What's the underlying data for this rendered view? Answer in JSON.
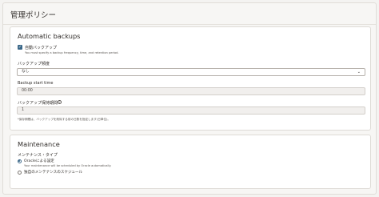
{
  "page": {
    "title": "管理ポリシー"
  },
  "backups": {
    "title": "Automatic backups",
    "auto_backup": {
      "label": "自動バックアップ",
      "hint": "You must specify a backup frequency, time, and retention period."
    },
    "frequency": {
      "label": "バックアップ頻度",
      "value": "なし"
    },
    "start_time": {
      "label": "Backup start time",
      "value": "00:00"
    },
    "retention": {
      "label": "バックアップ保持期間",
      "value": "1"
    },
    "note": "*保存期間は、バックアップを削除する前の日数を指定します(日単位)。"
  },
  "maintenance": {
    "title": "Maintenance",
    "type_label": "メンテナンス・タイプ",
    "options": [
      {
        "label": "Oracleによる設定",
        "hint": "Your maintenance will be scheduled by Oracle automatically.",
        "selected": true
      },
      {
        "label": "独自のメンテナンスのスケジュール",
        "selected": false
      }
    ]
  },
  "icons": {
    "checkbox": "checkmark-icon",
    "dropdown": "chevron-down-icon",
    "info": "info-icon"
  }
}
